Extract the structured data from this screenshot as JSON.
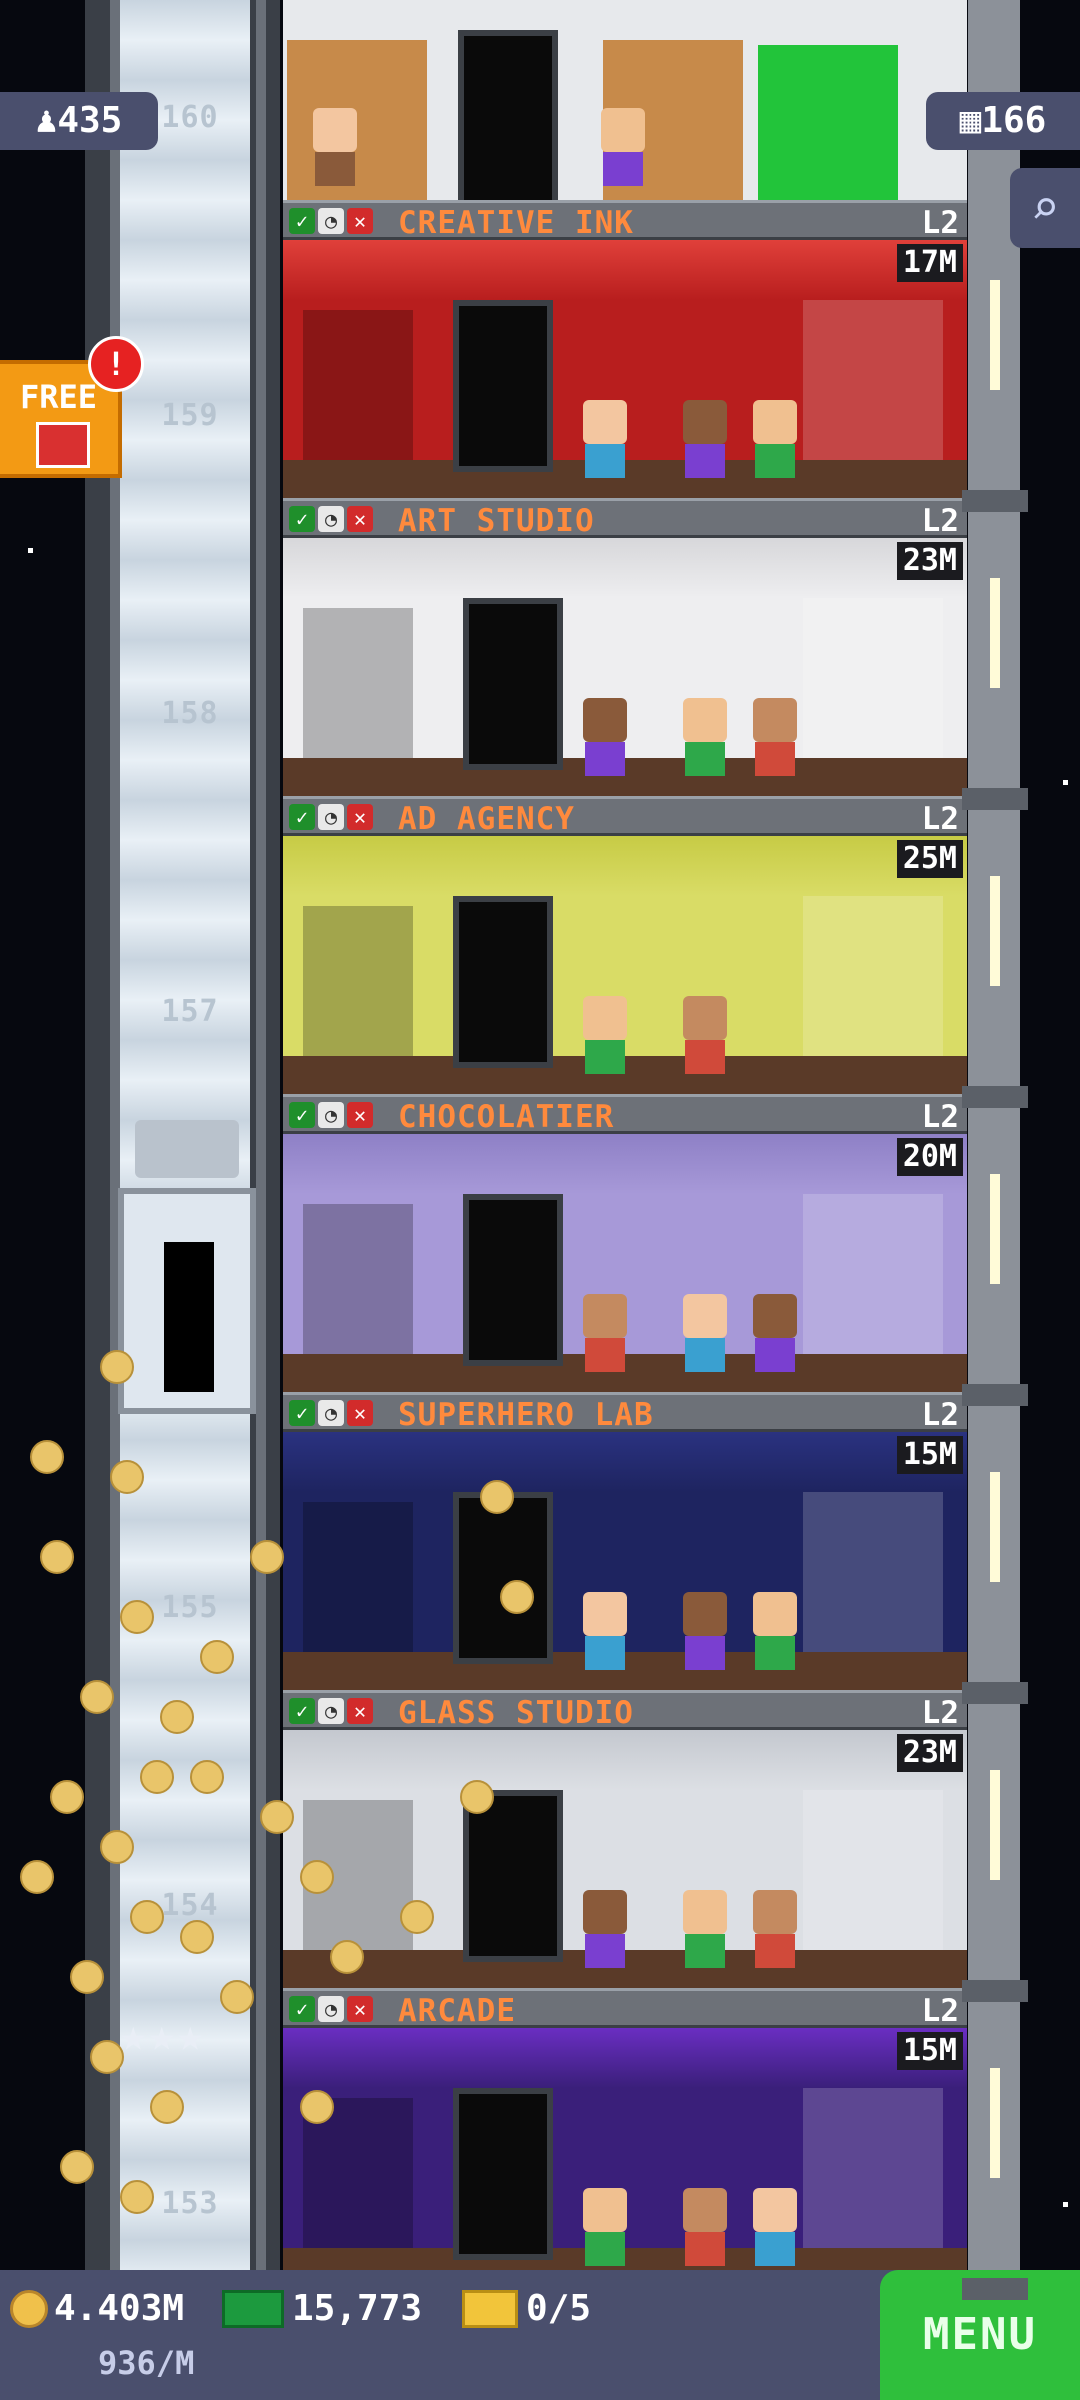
{
  "hud": {
    "population": "435",
    "floor_count": "166",
    "free_label": "FREE",
    "free_alert": "!",
    "menu_label": "MENU"
  },
  "currency": {
    "coins": "4.403M",
    "coin_rate": "936/M",
    "bux": "15,773",
    "tickets": "0/5"
  },
  "shaft_floor_numbers": [
    "160",
    "159",
    "158",
    "157",
    "155",
    "154",
    "153"
  ],
  "floors": [
    {
      "name": "CREATIVE INK",
      "level": "L2",
      "price": "17M",
      "bg": "#b81e1e",
      "accent": "#e0403a"
    },
    {
      "name": "ART STUDIO",
      "level": "L2",
      "price": "23M",
      "bg": "#eeeef0",
      "accent": "#d7d7da"
    },
    {
      "name": "AD AGENCY",
      "level": "L2",
      "price": "25M",
      "bg": "#d9dc66",
      "accent": "#c7cb45"
    },
    {
      "name": "CHOCOLATIER",
      "level": "L2",
      "price": "20M",
      "bg": "#a799d8",
      "accent": "#8e80c6"
    },
    {
      "name": "SUPERHERO LAB",
      "level": "L2",
      "price": "15M",
      "bg": "#1e2460",
      "accent": "#2a3280"
    },
    {
      "name": "GLASS STUDIO",
      "level": "L2",
      "price": "23M",
      "bg": "#dcdfe4",
      "accent": "#c4c8cf"
    },
    {
      "name": "ARCADE",
      "level": "L2",
      "price": "15M",
      "bg": "#3a1f7a",
      "accent": "#6a2ec2"
    }
  ],
  "colors": {
    "floor_name": "#ff8a3d",
    "hud_bg": "#4a4f6d",
    "menu_green": "#2fbf3c"
  },
  "icons": {
    "stock_ok": "check-icon",
    "timer": "clock-icon",
    "cancel": "x-icon",
    "search": "magnifier-icon",
    "population": "person-icon",
    "floors": "building-icon"
  }
}
